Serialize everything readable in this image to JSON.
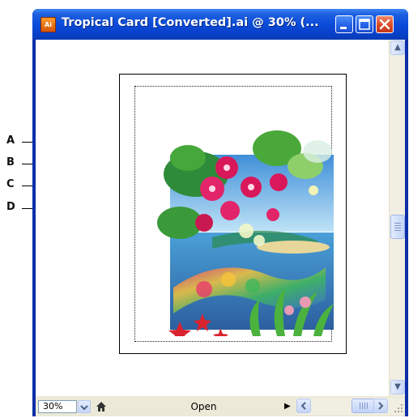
{
  "window": {
    "app_icon_text": "Ai",
    "title": "Tropical Card [Converted].ai @ 30% (...",
    "controls": {
      "minimize_icon": "minimize-icon",
      "maximize_icon": "maximize-icon",
      "close_icon": "close-icon"
    }
  },
  "callouts": [
    "A",
    "B",
    "C",
    "D"
  ],
  "status_bar": {
    "zoom_value": "30%",
    "status_text": "Open"
  },
  "colors": {
    "titlebar": "#0b4bd9",
    "window_frame": "#0a2fa8",
    "close_button": "#dc4a24",
    "statusbar": "#ece9d8"
  }
}
